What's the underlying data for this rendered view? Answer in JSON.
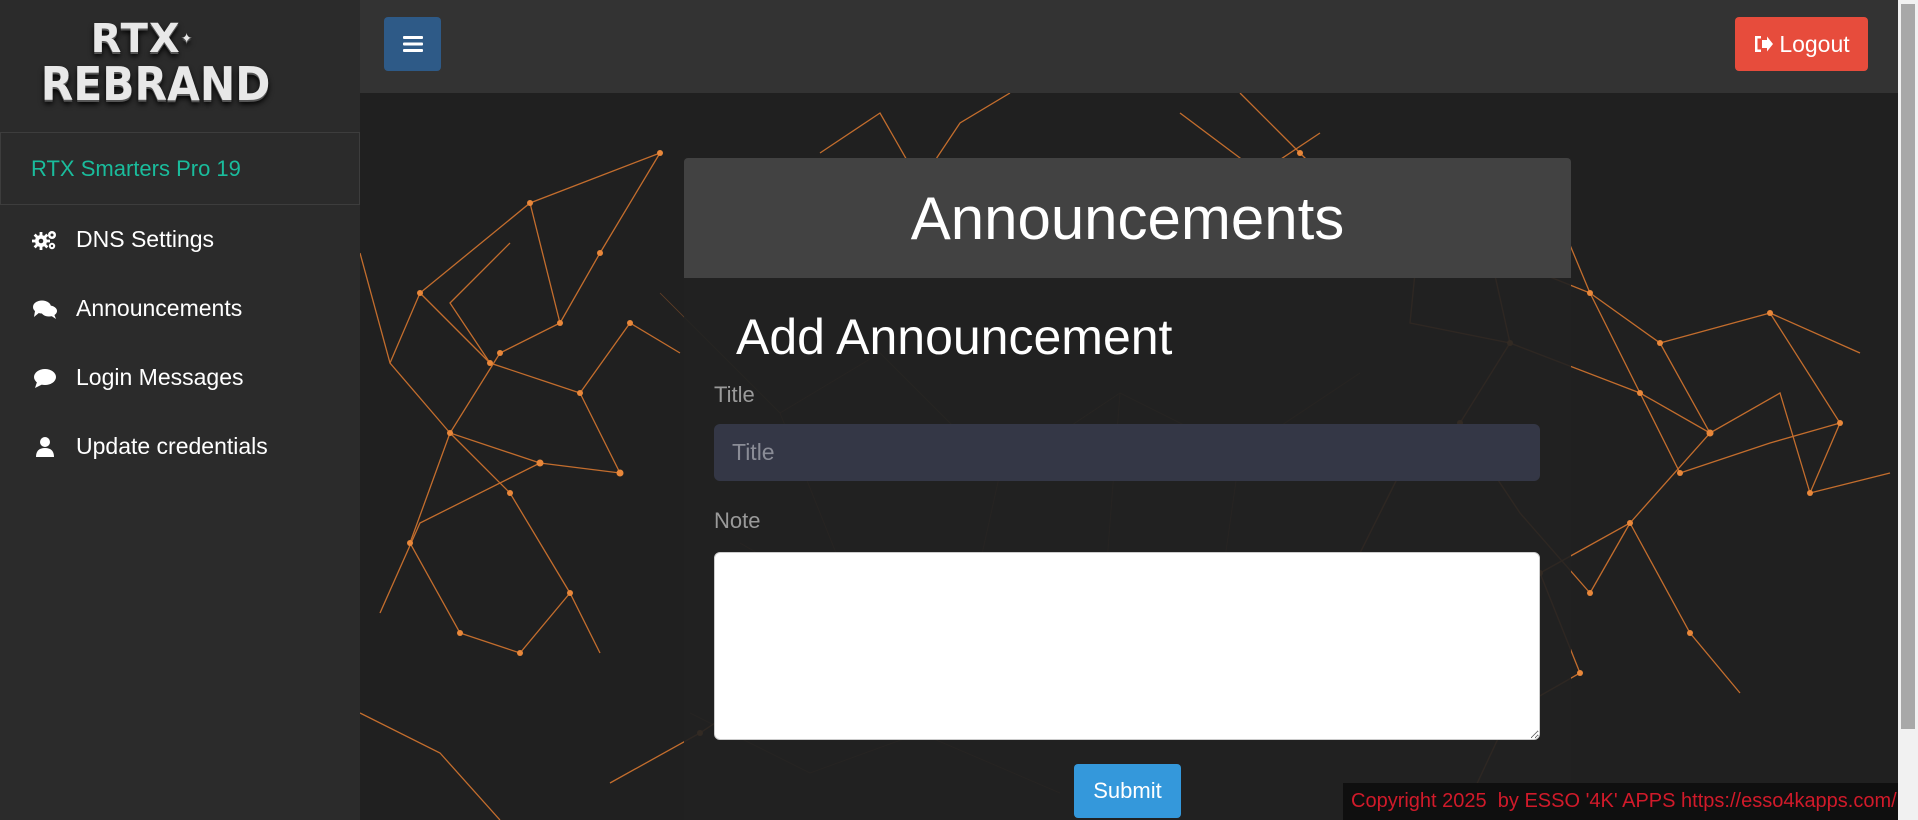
{
  "logo": {
    "line1": "RTX",
    "line2": "REBRAND"
  },
  "sidebar": {
    "brand": "RTX Smarters Pro 19",
    "items": [
      {
        "label": "DNS Settings",
        "icon": "gears-icon"
      },
      {
        "label": "Announcements",
        "icon": "comments-icon"
      },
      {
        "label": "Login Messages",
        "icon": "comment-icon"
      },
      {
        "label": "Update credentials",
        "icon": "user-icon"
      }
    ]
  },
  "topbar": {
    "menu_icon": "hamburger-icon",
    "logout_label": "Logout",
    "logout_icon": "sign-out-icon"
  },
  "panel": {
    "heading": "Announcements",
    "form_title": "Add Announcement",
    "title_label": "Title",
    "title_placeholder": "Title",
    "title_value": "",
    "note_label": "Note",
    "note_value": "",
    "submit_label": "Submit"
  },
  "footer": {
    "text": "Copyright 2025  by ESSO '4K' APPS https://esso4kapps.com/"
  },
  "colors": {
    "sidebar_bg": "#2b2b2b",
    "brand_text": "#1abc9c",
    "menu_button": "#2e5a87",
    "logout_button": "#e74c3c",
    "submit_button": "#3498db",
    "network_lines": "#e07b30",
    "footer_text": "#d11a2a"
  }
}
